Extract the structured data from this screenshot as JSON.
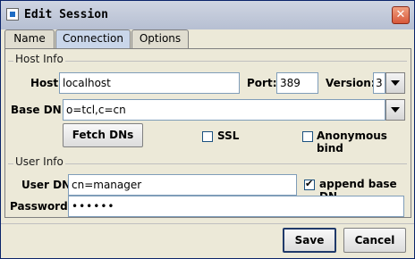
{
  "window": {
    "title": "Edit Session",
    "close_label": "✕"
  },
  "tabs": [
    {
      "label": "Name"
    },
    {
      "label": "Connection",
      "active": true
    },
    {
      "label": "Options"
    }
  ],
  "host_info": {
    "title": "Host Info",
    "host_label": "Host:",
    "host_value": "localhost",
    "port_label": "Port:",
    "port_value": "389",
    "version_label": "Version:",
    "version_value": "3",
    "base_dn_label": "Base DN:",
    "base_dn_value": "o=tcl,c=cn",
    "fetch_dns_label": "Fetch DNs",
    "ssl_label": "SSL",
    "ssl_checked": false,
    "anonymous_bind_label": "Anonymous bind",
    "anonymous_bind_checked": false
  },
  "user_info": {
    "title": "User Info",
    "user_dn_label": "User DN:",
    "user_dn_value": "cn=manager",
    "append_base_dn_label": "append base DN",
    "append_base_dn_checked": true,
    "password_label": "Password:",
    "password_value": "••••••"
  },
  "footer": {
    "save_label": "Save",
    "cancel_label": "Cancel"
  }
}
